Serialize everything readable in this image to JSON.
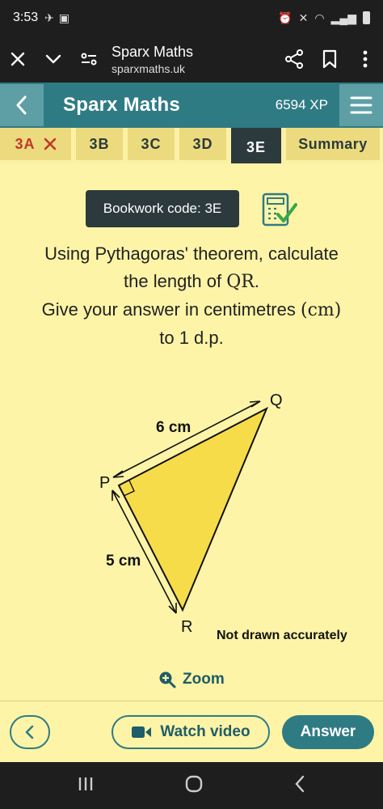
{
  "status": {
    "time": "3:53"
  },
  "browser": {
    "title": "Sparx Maths",
    "url": "sparxmaths.uk"
  },
  "app": {
    "title": "Sparx Maths",
    "xp": "6594 XP"
  },
  "tabs": [
    {
      "label": "3A"
    },
    {
      "label": "3B"
    },
    {
      "label": "3C"
    },
    {
      "label": "3D"
    },
    {
      "label": "3E"
    },
    {
      "label": "Summary"
    }
  ],
  "bookwork": {
    "label": "Bookwork code: 3E"
  },
  "question": {
    "line1": "Using Pythagoras' theorem, calculate",
    "line2_pre": "the length of ",
    "line2_math": "QR",
    "line2_post": ".",
    "line3_pre": "Give your answer in centimetres ",
    "line3_math": "(cm)",
    "line4": "to 1 d.p."
  },
  "diagram": {
    "vertex_p": "P",
    "vertex_q": "Q",
    "vertex_r": "R",
    "side_pq": "6 cm",
    "side_pr": "5 cm",
    "note": "Not drawn accurately",
    "fill": "#f7dc4a"
  },
  "zoom": {
    "label": "Zoom"
  },
  "actions": {
    "watch_label": "Watch video",
    "answer_label": "Answer"
  },
  "colors": {
    "primary": "#2f7b84",
    "background": "#fdf4a7",
    "dark": "#2c3a3d"
  }
}
